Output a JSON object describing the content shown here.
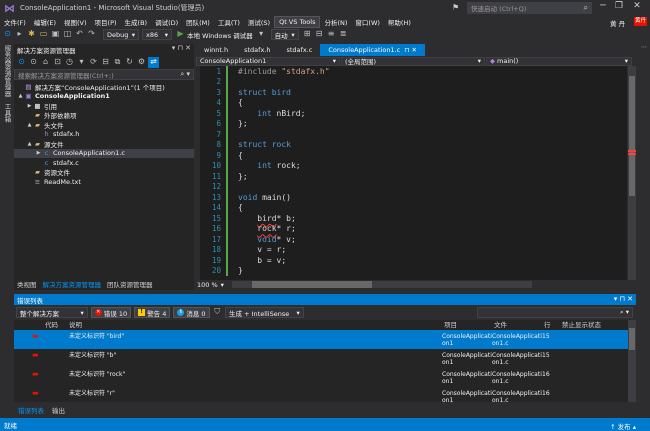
{
  "window": {
    "title": "ConsoleApplication1 - Microsoft Visual Studio(管理员)",
    "quick_launch_placeholder": "快速启动 (Ctrl+Q)",
    "minimize": "─",
    "restore": "❐",
    "close": "✕"
  },
  "menu": {
    "items": [
      "文件(F)",
      "编辑(E)",
      "视图(V)",
      "项目(P)",
      "生成(B)",
      "调试(D)",
      "团队(M)",
      "工具(T)",
      "测试(S)",
      "Qt VS Tools",
      "分析(N)",
      "窗口(W)",
      "帮助(H)"
    ],
    "active_index": 9,
    "user": "黄 丹",
    "user_badge": "黄丹"
  },
  "toolbar": {
    "config": "Debug",
    "platform": "x86",
    "run_label": "本地 Windows 调试器",
    "run_mode": "自动"
  },
  "vertical_tabs": [
    "服务器资源管理器",
    "工具箱"
  ],
  "solution_explorer": {
    "title": "解决方案资源管理器",
    "search_placeholder": "搜索解决方案资源管理器(Ctrl+;)",
    "items": [
      {
        "depth": 0,
        "arrow": "",
        "icon": "solution-icon",
        "label": "解决方案“ConsoleApplication1”(1 个项目)",
        "bold": false
      },
      {
        "depth": 0,
        "arrow": "▲",
        "icon": "project-icon",
        "label": "ConsoleApplication1",
        "bold": true
      },
      {
        "depth": 1,
        "arrow": "▶",
        "icon": "references-icon",
        "label": "引用",
        "bold": false
      },
      {
        "depth": 1,
        "arrow": "",
        "icon": "external-deps-icon",
        "label": "外部依赖项",
        "bold": false
      },
      {
        "depth": 1,
        "arrow": "▲",
        "icon": "folder-icon",
        "label": "头文件",
        "bold": false
      },
      {
        "depth": 2,
        "arrow": "",
        "icon": "header-file-icon",
        "label": "stdafx.h",
        "bold": false
      },
      {
        "depth": 1,
        "arrow": "▲",
        "icon": "folder-icon",
        "label": "源文件",
        "bold": false
      },
      {
        "depth": 2,
        "arrow": "▶",
        "icon": "c-file-icon",
        "label": "ConsoleApplication1.c",
        "bold": false,
        "selected": true
      },
      {
        "depth": 2,
        "arrow": "",
        "icon": "c-file-icon",
        "label": "stdafx.c",
        "bold": false
      },
      {
        "depth": 1,
        "arrow": "",
        "icon": "folder-icon",
        "label": "资源文件",
        "bold": false
      },
      {
        "depth": 1,
        "arrow": "",
        "icon": "text-file-icon",
        "label": "ReadMe.txt",
        "bold": false
      }
    ],
    "bottom_tabs": [
      "类视图",
      "解决方案资源管理器",
      "团队资源管理器"
    ],
    "active_bottom_tab": 1
  },
  "editor": {
    "tabs": [
      "winnt.h",
      "stdafx.h",
      "stdafx.c",
      "ConsoleApplication1.c"
    ],
    "active_tab": 3,
    "nav_project": "ConsoleApplication1",
    "nav_scope": "(全局范围)",
    "nav_member": "main()",
    "zoom": "100 %",
    "lines": [
      {
        "n": "1",
        "segs": [
          {
            "t": "#include ",
            "c": "pp"
          },
          {
            "t": "\"stdafx.h\"",
            "c": "str"
          }
        ]
      },
      {
        "n": "2",
        "segs": []
      },
      {
        "n": "3",
        "segs": [
          {
            "t": "struct ",
            "c": "kw"
          },
          {
            "t": "bird",
            "c": "kw"
          }
        ]
      },
      {
        "n": "4",
        "segs": [
          {
            "t": "{",
            "c": "code"
          }
        ]
      },
      {
        "n": "5",
        "segs": [
          {
            "t": "    ",
            "c": "code"
          },
          {
            "t": "int",
            "c": "kw"
          },
          {
            "t": " nBird;",
            "c": "code"
          }
        ]
      },
      {
        "n": "6",
        "segs": [
          {
            "t": "};",
            "c": "code"
          }
        ]
      },
      {
        "n": "7",
        "segs": []
      },
      {
        "n": "8",
        "segs": [
          {
            "t": "struct ",
            "c": "kw"
          },
          {
            "t": "rock",
            "c": "kw"
          }
        ]
      },
      {
        "n": "9",
        "segs": [
          {
            "t": "{",
            "c": "code"
          }
        ]
      },
      {
        "n": "10",
        "segs": [
          {
            "t": "    ",
            "c": "code"
          },
          {
            "t": "int",
            "c": "kw"
          },
          {
            "t": " rock;",
            "c": "code"
          }
        ]
      },
      {
        "n": "11",
        "segs": [
          {
            "t": "};",
            "c": "code"
          }
        ]
      },
      {
        "n": "12",
        "segs": []
      },
      {
        "n": "13",
        "segs": [
          {
            "t": "void",
            "c": "kw"
          },
          {
            "t": " main()",
            "c": "code"
          }
        ]
      },
      {
        "n": "14",
        "segs": [
          {
            "t": "{",
            "c": "code"
          }
        ]
      },
      {
        "n": "15",
        "segs": [
          {
            "t": "    ",
            "c": "code"
          },
          {
            "t": "bird",
            "c": "code err"
          },
          {
            "t": "* b;",
            "c": "code"
          }
        ]
      },
      {
        "n": "16",
        "segs": [
          {
            "t": "    ",
            "c": "code"
          },
          {
            "t": "rock",
            "c": "code err"
          },
          {
            "t": "* r;",
            "c": "code"
          }
        ]
      },
      {
        "n": "17",
        "segs": [
          {
            "t": "    ",
            "c": "code"
          },
          {
            "t": "void",
            "c": "kw"
          },
          {
            "t": "* v;",
            "c": "code"
          }
        ]
      },
      {
        "n": "18",
        "segs": [
          {
            "t": "    v = r;",
            "c": "code"
          }
        ]
      },
      {
        "n": "19",
        "segs": [
          {
            "t": "    b = v;",
            "c": "code"
          }
        ]
      },
      {
        "n": "20",
        "segs": [
          {
            "t": "}",
            "c": "code"
          }
        ]
      }
    ]
  },
  "error_list": {
    "title": "错误列表",
    "scope": "整个解决方案",
    "errors_label": "错误 10",
    "warnings_label": "警告 4",
    "messages_label": "消息 0",
    "build_filter": "生成 + IntelliSense",
    "columns": {
      "code": "代码",
      "desc": "说明",
      "project": "项目",
      "file": "文件",
      "line": "行",
      "suppress": "禁止显示状态"
    },
    "rows": [
      {
        "desc": "未定义标识符 \"bird\"",
        "project1": "ConsoleApplicati",
        "project2": "on1",
        "file1": "ConsoleApplicati",
        "file2": "on1.c",
        "line": "15",
        "selected": true
      },
      {
        "desc": "未定义标识符 \"b\"",
        "project1": "ConsoleApplicati",
        "project2": "on1",
        "file1": "ConsoleApplicati",
        "file2": "on1.c",
        "line": "15",
        "selected": false
      },
      {
        "desc": "未定义标识符 \"rock\"",
        "project1": "ConsoleApplicati",
        "project2": "on1",
        "file1": "ConsoleApplicati",
        "file2": "on1.c",
        "line": "16",
        "selected": false
      },
      {
        "desc": "未定义标识符 \"r\"",
        "project1": "ConsoleApplicati",
        "project2": "on1",
        "file1": "ConsoleApplicati",
        "file2": "on1.c",
        "line": "16",
        "selected": false
      }
    ],
    "bottom_tabs": [
      "错误列表",
      "输出"
    ],
    "active_bottom_tab": 0
  },
  "status": {
    "left": "就绪",
    "publish": "发布"
  },
  "colors": {
    "accent": "#007acc",
    "error": "#e51400",
    "warning": "#ffcc00",
    "message": "#1ba1e2"
  }
}
